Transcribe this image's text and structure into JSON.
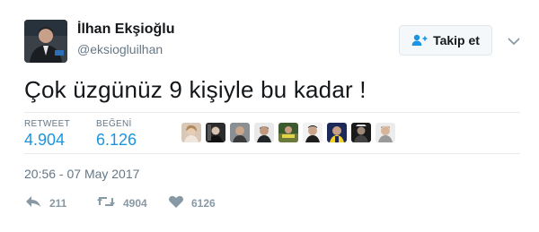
{
  "profile": {
    "name": "İlhan Ekşioğlu",
    "handle": "@eksiogluilhan"
  },
  "follow_button": {
    "label": "Takip et",
    "icon": "add-user-icon"
  },
  "tweet": {
    "text": "Çok üzgünüz 9 kişiyle bu kadar !",
    "timestamp": "20:56 - 07 May 2017"
  },
  "stats": {
    "retweets_label": "RETWEET",
    "retweets_value": "4.904",
    "likes_label": "BEĞENİ",
    "likes_value": "6.126"
  },
  "likers": {
    "count": 9
  },
  "actions": {
    "reply_count": "211",
    "retweet_count": "4904",
    "like_count": "6126"
  },
  "colors": {
    "accent": "#1b95e0",
    "muted": "#657786",
    "icon_gray": "#8899a6",
    "divider": "#e6ecf0"
  }
}
